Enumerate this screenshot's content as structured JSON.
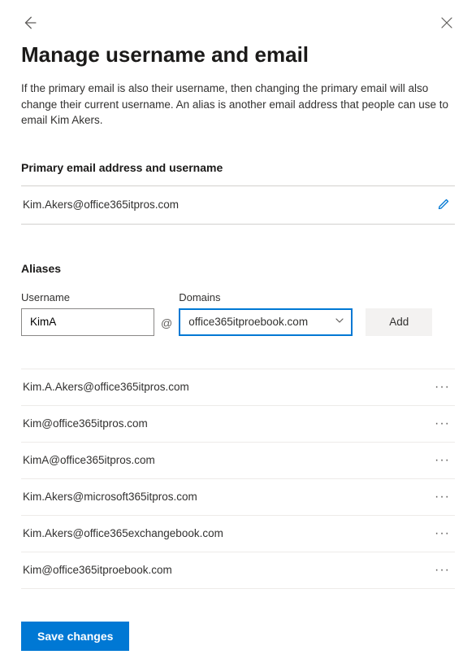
{
  "header": {
    "title": "Manage username and email",
    "description": "If the primary email is also their username, then changing the primary email will also change their current username. An alias is another email address that people can use to email Kim Akers."
  },
  "primary": {
    "section_label": "Primary email address and username",
    "value": "Kim.Akers@office365itpros.com"
  },
  "aliases": {
    "section_label": "Aliases",
    "username_label": "Username",
    "username_value": "KimA",
    "at": "@",
    "domains_label": "Domains",
    "domain_selected": "office365itproebook.com",
    "add_label": "Add",
    "items": [
      {
        "email": "Kim.A.Akers@office365itpros.com"
      },
      {
        "email": "Kim@office365itpros.com"
      },
      {
        "email": "KimA@office365itpros.com"
      },
      {
        "email": "Kim.Akers@microsoft365itpros.com"
      },
      {
        "email": "Kim.Akers@office365exchangebook.com"
      },
      {
        "email": "Kim@office365itproebook.com"
      }
    ]
  },
  "footer": {
    "save_label": "Save changes"
  }
}
